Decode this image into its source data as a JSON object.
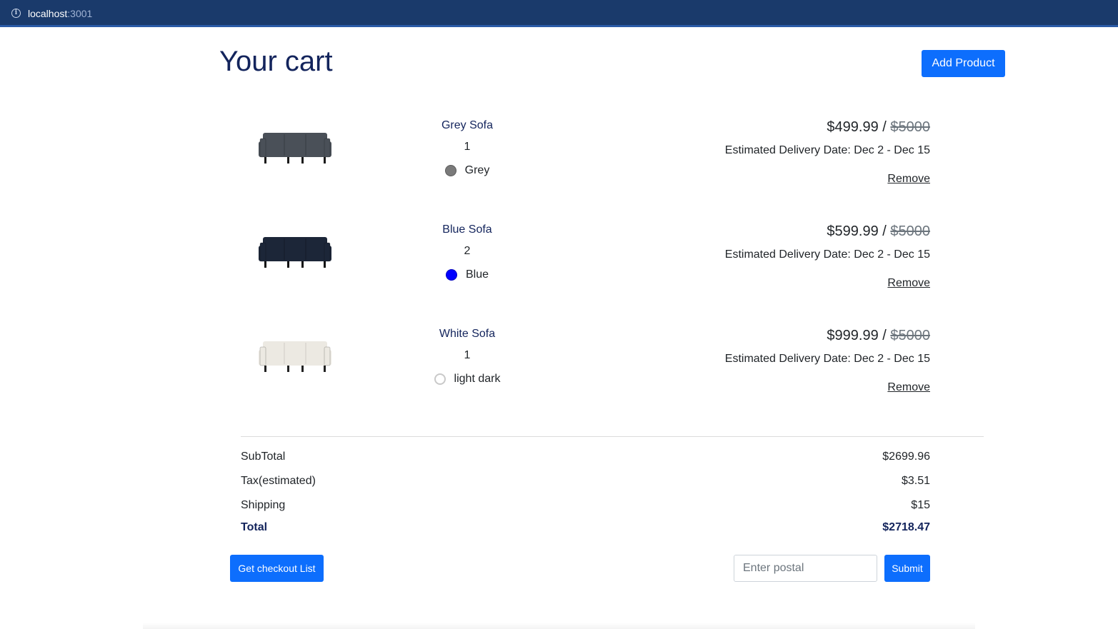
{
  "browser": {
    "url_host": "localhost",
    "url_port": ":3001"
  },
  "header": {
    "title": "Your cart",
    "add_product_label": "Add Product"
  },
  "items": [
    {
      "name": "Grey Sofa",
      "quantity": "1",
      "color_name": "Grey",
      "swatch_color": "#7a7a7a",
      "sofa_color": "#4a5058",
      "price": "$499.99",
      "separator": " / ",
      "original_price": "$5000",
      "delivery": "Estimated Delivery Date: Dec 2 - Dec 15",
      "remove_label": "Remove"
    },
    {
      "name": "Blue Sofa",
      "quantity": "2",
      "color_name": "Blue",
      "swatch_color": "#0000ff",
      "sofa_color": "#1c2638",
      "price": "$599.99",
      "separator": " / ",
      "original_price": "$5000",
      "delivery": "Estimated Delivery Date: Dec 2 - Dec 15",
      "remove_label": "Remove"
    },
    {
      "name": "White Sofa",
      "quantity": "1",
      "color_name": "light dark",
      "swatch_color": "#ffffff",
      "sofa_color": "#ece9e2",
      "price": "$999.99",
      "separator": " / ",
      "original_price": "$5000",
      "delivery": "Estimated Delivery Date: Dec 2 - Dec 15",
      "remove_label": "Remove"
    }
  ],
  "summary": {
    "subtotal_label": "SubTotal",
    "subtotal_value": "$2699.96",
    "tax_label": "Tax(estimated)",
    "tax_value": "$3.51",
    "shipping_label": "Shipping",
    "shipping_value": "$15",
    "total_label": "Total",
    "total_value": "$2718.47"
  },
  "footer": {
    "checkout_label": "Get checkout List",
    "postal_placeholder": "Enter postal",
    "postal_value": "",
    "submit_label": "Submit"
  },
  "colors": {
    "accent": "#0d6efd",
    "title": "#13245c",
    "topbar": "#1a3a6b"
  }
}
